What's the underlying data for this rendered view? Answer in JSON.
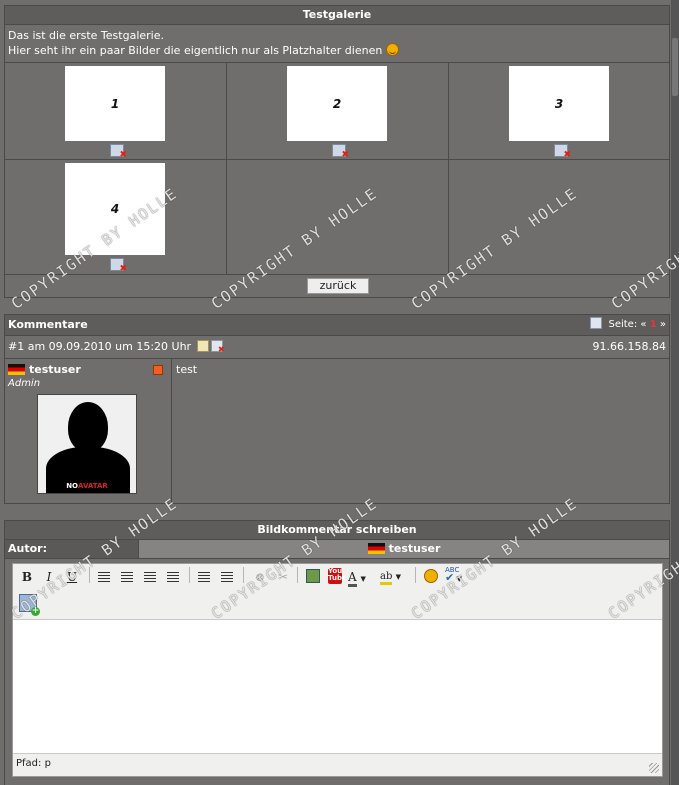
{
  "gallery": {
    "title": "Testgalerie",
    "description_line1": "Das ist die erste Testgalerie.",
    "description_line2": "Hier seht ihr ein paar Bilder die eigentlich nur als Platzhalter dienen",
    "images": [
      {
        "label": "1"
      },
      {
        "label": "2"
      },
      {
        "label": "3"
      },
      {
        "label": "4"
      }
    ],
    "back_button": "zurück"
  },
  "comments": {
    "title": "Kommentare",
    "page_label": "Seite:",
    "prev_arrow": "«",
    "current_page": "1",
    "next_arrow": "»",
    "entry": {
      "meta": "#1 am 09.09.2010 um 15:20 Uhr",
      "ip": "91.66.158.84",
      "author": "testuser",
      "role": "Admin",
      "avatar_text_a": "NO",
      "avatar_text_b": "AVATAR",
      "text": "test"
    }
  },
  "write": {
    "title": "Bildkommentar schreiben",
    "author_label": "Autor:",
    "author_value": "testuser",
    "editor_toolbar": {
      "bold": "B",
      "italic": "I",
      "underline": "U",
      "youtube": "You Tube",
      "font_color": "A",
      "highlight": "ab",
      "spell": "ABC"
    },
    "path_label": "Pfad: p"
  },
  "watermark": "COPYRIGHT BY HOLLE",
  "colors": {
    "panel_bg": "#6f6e6c",
    "header_bg": "#5e5d5b",
    "accent_red": "#e33"
  }
}
